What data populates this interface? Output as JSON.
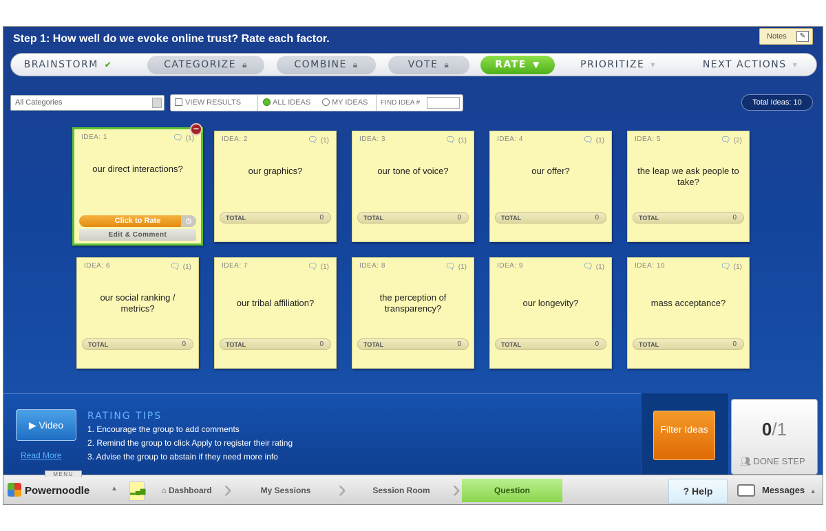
{
  "header": {
    "step_title": "Step 1: How well do we evoke online trust? Rate each factor.",
    "notes_label": "Notes"
  },
  "steps": [
    {
      "label": "BRAINSTORM",
      "state": "done",
      "icon": "check-icon"
    },
    {
      "label": "CATEGORIZE",
      "state": "locked",
      "icon": "lock-icon"
    },
    {
      "label": "COMBINE",
      "state": "locked",
      "icon": "lock-icon"
    },
    {
      "label": "VOTE",
      "state": "locked",
      "icon": "lock-icon"
    },
    {
      "label": "RATE",
      "state": "active",
      "icon": "caret-down-icon"
    },
    {
      "label": "PRIORITIZE",
      "state": "future",
      "icon": "caret-down-icon"
    },
    {
      "label": "NEXT ACTIONS",
      "state": "future",
      "icon": "caret-down-icon"
    }
  ],
  "filters": {
    "category_select": "All Categories",
    "view_results": "VIEW RESULTS",
    "all_ideas": "ALL IDEAS",
    "my_ideas": "MY IDEAS",
    "find_idea": "FIND IDEA #",
    "selected_view": "ALL IDEAS",
    "total_ideas": "Total Ideas: 10"
  },
  "ideas": [
    {
      "id_label": "IDEA: 1",
      "comments": "(1)",
      "text": "our direct interactions?",
      "total_label": "TOTAL",
      "total": "0",
      "selected": true
    },
    {
      "id_label": "IDEA: 2",
      "comments": "(1)",
      "text": "our graphics?",
      "total_label": "TOTAL",
      "total": "0"
    },
    {
      "id_label": "IDEA: 3",
      "comments": "(1)",
      "text": "our tone of voice?",
      "total_label": "TOTAL",
      "total": "0"
    },
    {
      "id_label": "IDEA: 4",
      "comments": "(1)",
      "text": "our offer?",
      "total_label": "TOTAL",
      "total": "0"
    },
    {
      "id_label": "IDEA: 5",
      "comments": "(2)",
      "text": "the leap we ask people to take?",
      "total_label": "TOTAL",
      "total": "0"
    },
    {
      "id_label": "IDEA: 6",
      "comments": "(1)",
      "text": "our social ranking / metrics?",
      "total_label": "TOTAL",
      "total": "0"
    },
    {
      "id_label": "IDEA: 7",
      "comments": "(1)",
      "text": "our tribal affiliation?",
      "total_label": "TOTAL",
      "total": "0"
    },
    {
      "id_label": "IDEA: 8",
      "comments": "(1)",
      "text": "the perception of transparency?",
      "total_label": "TOTAL",
      "total": "0"
    },
    {
      "id_label": "IDEA: 9",
      "comments": "(1)",
      "text": "our longevity?",
      "total_label": "TOTAL",
      "total": "0"
    },
    {
      "id_label": "IDEA: 10",
      "comments": "(1)",
      "text": "mass acceptance?",
      "total_label": "TOTAL",
      "total": "0"
    }
  ],
  "selected_card": {
    "rate_label": "Click to Rate",
    "edit_label": "Edit & Comment"
  },
  "tips": {
    "video_label": "Video",
    "read_more": "Read More",
    "title": "RATING TIPS",
    "items": [
      "1. Encourage the group to add comments",
      "2. Remind the group to click Apply to register their rating",
      "3. Advise the group to abstain if they need more info"
    ]
  },
  "actions": {
    "filter_ideas": "Filter Ideas",
    "done_count": "0",
    "done_total": "/1",
    "done_label": "DONE STEP"
  },
  "footer": {
    "menu_label": "MENU",
    "brand": "Powernoodle",
    "breadcrumbs": [
      "Dashboard",
      "My Sessions",
      "Session Room",
      "Question"
    ],
    "help_label": "Help",
    "messages_label": "Messages"
  },
  "colors": {
    "accent_green": "#5cc232",
    "background_blue": "#1a4fa3",
    "card_yellow": "#fbf7b5",
    "filter_orange": "#e67a0f"
  }
}
